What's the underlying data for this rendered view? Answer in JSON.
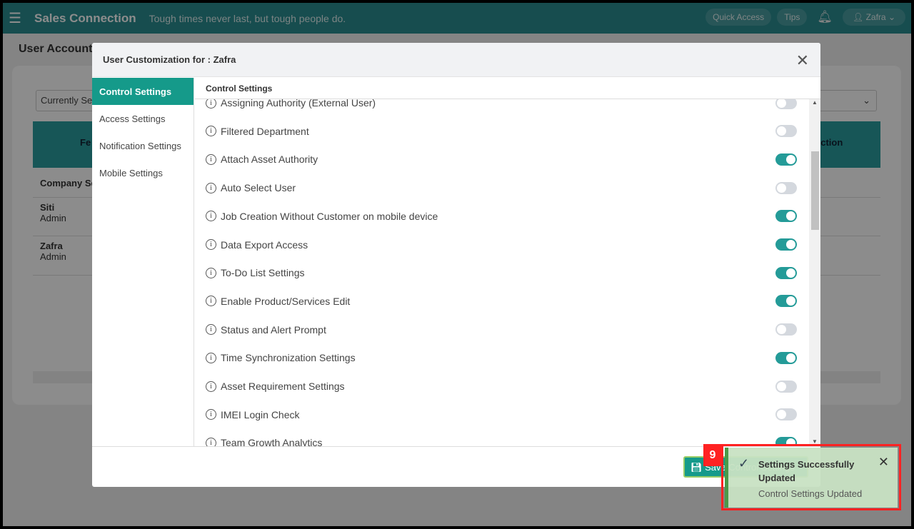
{
  "header": {
    "brand": "Sales Connection",
    "tagline": "Tough times never last, but tough people do.",
    "quick_access": "Quick Access",
    "tips": "Tips",
    "user": "Zafra"
  },
  "page": {
    "title": "User Account",
    "select_value": "Currently Se",
    "table_header_left": "Fe",
    "table_header_right": "ection",
    "rows": [
      {
        "name": "Company Se",
        "role": ""
      },
      {
        "name": "Siti",
        "role": "Admin"
      },
      {
        "name": "Zafra",
        "role": "Admin"
      }
    ]
  },
  "modal": {
    "title": "User Customization for : Zafra",
    "section_title": "Control Settings",
    "save_label": "Save Control Settings",
    "tabs": [
      "Control Settings",
      "Access Settings",
      "Notification Settings",
      "Mobile Settings"
    ],
    "settings": [
      {
        "label": "Assigning Authority (External User)",
        "on": false
      },
      {
        "label": "Filtered Department",
        "on": false
      },
      {
        "label": "Attach Asset Authority",
        "on": true
      },
      {
        "label": "Auto Select User",
        "on": false
      },
      {
        "label": "Job Creation Without Customer on mobile device",
        "on": true
      },
      {
        "label": "Data Export Access",
        "on": true
      },
      {
        "label": "To-Do List Settings",
        "on": true
      },
      {
        "label": "Enable Product/Services Edit",
        "on": true
      },
      {
        "label": "Status and Alert Prompt",
        "on": false
      },
      {
        "label": "Time Synchronization Settings",
        "on": true
      },
      {
        "label": "Asset Requirement Settings",
        "on": false
      },
      {
        "label": "IMEI Login Check",
        "on": false
      },
      {
        "label": "Team Growth Analytics",
        "on": true
      }
    ]
  },
  "toast": {
    "title": "Settings Successfully Updated",
    "message": "Control Settings Updated",
    "annotation": "9"
  }
}
